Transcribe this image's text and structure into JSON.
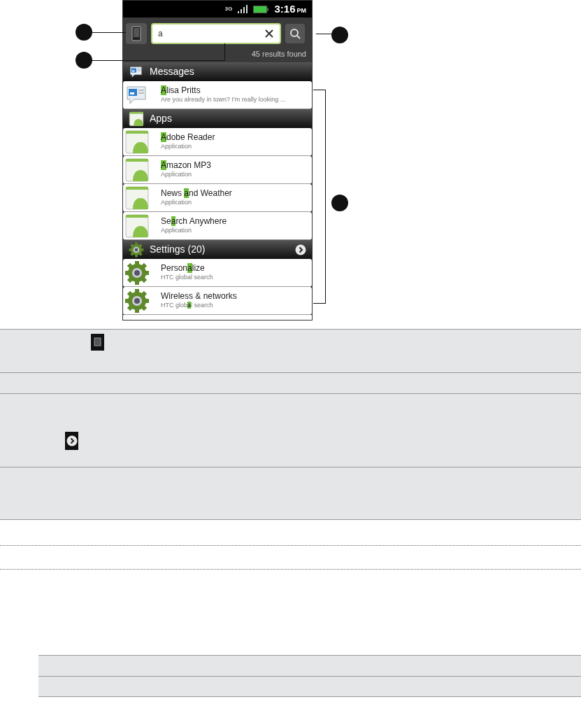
{
  "status_bar": {
    "network": "3G",
    "time": "3:16",
    "meridiem": "PM"
  },
  "search": {
    "value": "a",
    "results": "45 results found"
  },
  "groups": [
    {
      "kind": "messages",
      "title": "Messages",
      "more_arrow": false,
      "items": [
        {
          "title": [
            {
              "text": "A",
              "match": true
            },
            {
              "text": "lisa Pritts",
              "match": false
            }
          ],
          "subtitle": [
            {
              "text": "Are you already in town? I'm really looking ...",
              "match": false
            }
          ]
        }
      ]
    },
    {
      "kind": "apps",
      "title": "Apps",
      "more_arrow": false,
      "items": [
        {
          "title": [
            {
              "text": "A",
              "match": true
            },
            {
              "text": "dobe Reader",
              "match": false
            }
          ],
          "subtitle": [
            {
              "text": "Application",
              "match": false
            }
          ]
        },
        {
          "title": [
            {
              "text": "A",
              "match": true
            },
            {
              "text": "mazon MP3",
              "match": false
            }
          ],
          "subtitle": [
            {
              "text": "Application",
              "match": false
            }
          ]
        },
        {
          "title": [
            {
              "text": "News ",
              "match": false
            },
            {
              "text": "a",
              "match": true
            },
            {
              "text": "nd Weather",
              "match": false
            }
          ],
          "subtitle": [
            {
              "text": "Application",
              "match": false
            }
          ]
        },
        {
          "title": [
            {
              "text": "Se",
              "match": false
            },
            {
              "text": "a",
              "match": true
            },
            {
              "text": "rch Anywhere",
              "match": false
            }
          ],
          "subtitle": [
            {
              "text": "Application",
              "match": false
            }
          ]
        }
      ]
    },
    {
      "kind": "settings",
      "title": "Settings (20)",
      "more_arrow": true,
      "items": [
        {
          "title": [
            {
              "text": "Person",
              "match": false
            },
            {
              "text": "a",
              "match": true
            },
            {
              "text": "lize",
              "match": false
            }
          ],
          "subtitle": [
            {
              "text": "HTC global search",
              "match": false
            }
          ]
        },
        {
          "title": [
            {
              "text": "Wireless & networks",
              "match": false
            }
          ],
          "subtitle": [
            {
              "text": "HTC glob",
              "match": false
            },
            {
              "text": "a",
              "match": true
            },
            {
              "text": "l search",
              "match": false
            }
          ]
        }
      ]
    }
  ]
}
